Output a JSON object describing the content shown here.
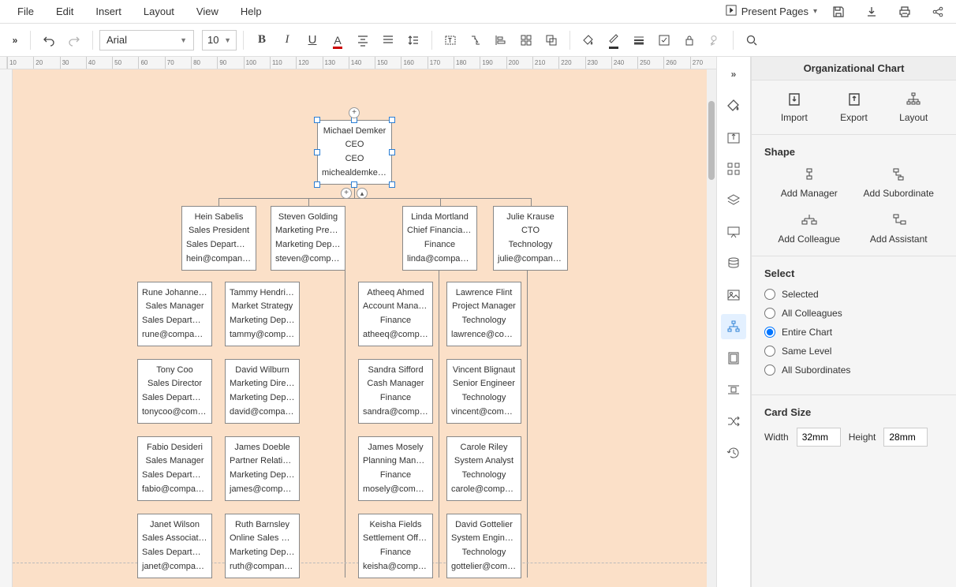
{
  "menu": {
    "file": "File",
    "edit": "Edit",
    "insert": "Insert",
    "layout": "Layout",
    "view": "View",
    "help": "Help"
  },
  "present": {
    "label": "Present Pages"
  },
  "toolbar": {
    "font": "Arial",
    "size": "10"
  },
  "ruler": {
    "start": 10,
    "step": 10,
    "count": 27
  },
  "panel": {
    "title": "Organizational Chart",
    "import": "Import",
    "export": "Export",
    "layout": "Layout",
    "shape": "Shape",
    "addManager": "Add Manager",
    "addSubordinate": "Add Subordinate",
    "addColleague": "Add Colleague",
    "addAssistant": "Add Assistant",
    "select": "Select",
    "opt_selected": "Selected",
    "opt_colleagues": "All Colleagues",
    "opt_entire": "Entire Chart",
    "opt_samelevel": "Same Level",
    "opt_subs": "All Subordinates",
    "cardSize": "Card Size",
    "width": "Width",
    "widthVal": "32mm",
    "height": "Height",
    "heightVal": "28mm"
  },
  "cards": {
    "root": {
      "name": "Michael Demker",
      "title": "CEO",
      "dept": "CEO",
      "email": "michealdemker..."
    },
    "l2a": {
      "name": "Hein Sabelis",
      "title": "Sales President",
      "dept": "Sales Department",
      "email": "hein@company...."
    },
    "l2b": {
      "name": "Steven Golding",
      "title": "Marketing Presi...",
      "dept": "Marketing Depar...",
      "email": "steven@compa..."
    },
    "l2c": {
      "name": "Linda Mortland",
      "title": "Chief Financial ...",
      "dept": "Finance",
      "email": "linda@company..."
    },
    "l2d": {
      "name": "Julie Krause",
      "title": "CTO",
      "dept": "Technology",
      "email": "julie@company..."
    },
    "c1": {
      "name": "Rune Johannes...",
      "title": "Sales Manager",
      "dept": "Sales Department",
      "email": "rune@company..."
    },
    "c2": {
      "name": "Tammy Hendrick...",
      "title": "Market Strategy",
      "dept": "Marketing Depar...",
      "email": "tammy@compa..."
    },
    "c3": {
      "name": "Atheeq Ahmed",
      "title": "Account Manager",
      "dept": "Finance",
      "email": "atheeq@compa..."
    },
    "c4": {
      "name": "Lawrence Flint",
      "title": "Project Manager",
      "dept": "Technology",
      "email": "lawrence@com..."
    },
    "c5": {
      "name": "Tony Coo",
      "title": "Sales Director",
      "dept": "Sales Department",
      "email": "tonycoo@comp..."
    },
    "c6": {
      "name": "David Wilburn",
      "title": "Marketing Director",
      "dept": "Marketing Depar...",
      "email": "david@company..."
    },
    "c7": {
      "name": "Sandra Sifford",
      "title": "Cash Manager",
      "dept": "Finance",
      "email": "sandra@compa..."
    },
    "c8": {
      "name": "Vincent Blignaut",
      "title": "Senior Engineer",
      "dept": "Technology",
      "email": "vincent@compa..."
    },
    "c9": {
      "name": "Fabio Desideri",
      "title": "Sales Manager",
      "dept": "Sales Department",
      "email": "fabio@company..."
    },
    "c10": {
      "name": "James Doeble",
      "title": "Partner Relations",
      "dept": "Marketing Depar...",
      "email": "james@compan..."
    },
    "c11": {
      "name": "James Mosely",
      "title": "Planning Manager",
      "dept": "Finance",
      "email": "mosely@compa..."
    },
    "c12": {
      "name": "Carole Riley",
      "title": "System Analyst",
      "dept": "Technology",
      "email": "carole@compan..."
    },
    "c13": {
      "name": "Janet Wilson",
      "title": "Sales Associate ...",
      "dept": "Sales Department",
      "email": "janet@company..."
    },
    "c14": {
      "name": "Ruth Barnsley",
      "title": "Online Sales Dir...",
      "dept": "Marketing Depar...",
      "email": "ruth@company..."
    },
    "c15": {
      "name": "Keisha Fields",
      "title": "Settlement Officer",
      "dept": "Finance",
      "email": "keisha@compa..."
    },
    "c16": {
      "name": "David Gottelier",
      "title": "System Engineer",
      "dept": "Technology",
      "email": "gottelier@comp..."
    }
  }
}
